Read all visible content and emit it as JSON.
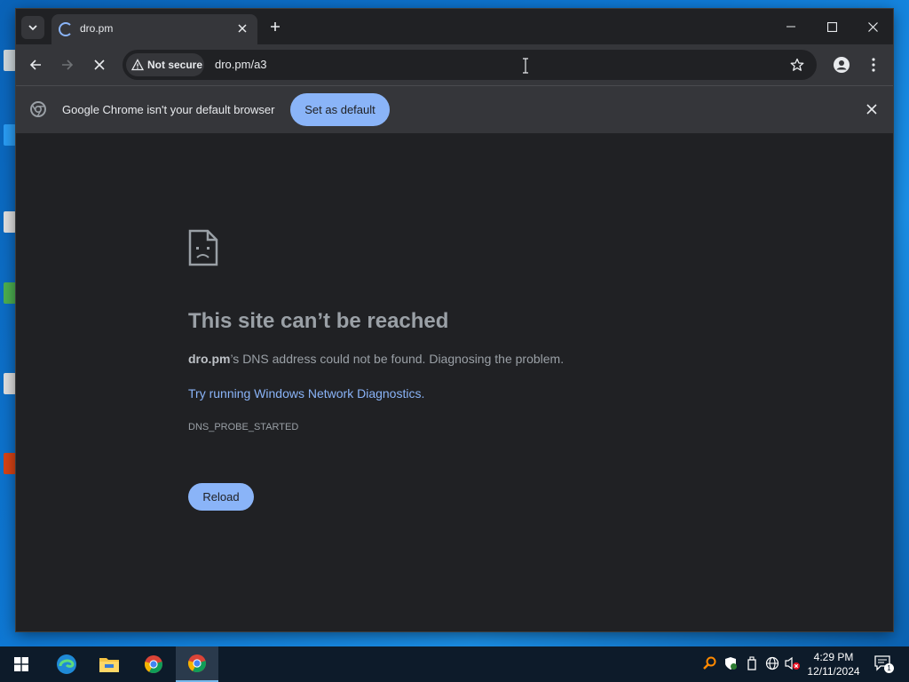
{
  "browser": {
    "tab": {
      "title": "dro.pm"
    },
    "security_chip": "Not secure",
    "url": "dro.pm/a3"
  },
  "infobar": {
    "message": "Google Chrome isn't your default browser",
    "button": "Set as default"
  },
  "error_page": {
    "headline": "This site can’t be reached",
    "domain": "dro.pm",
    "description_rest": "’s DNS address could not be found. Diagnosing the problem.",
    "link": "Try running Windows Network Diagnostics.",
    "error_code": "DNS_PROBE_STARTED",
    "reload_button": "Reload"
  },
  "taskbar": {
    "time": "4:29 PM",
    "date": "12/11/2024",
    "notification_count": "1"
  },
  "colors": {
    "accent": "#8ab4f8",
    "window_bg": "#202124",
    "toolbar_bg": "#35363a",
    "taskbar_bg": "#0d1b2a"
  }
}
